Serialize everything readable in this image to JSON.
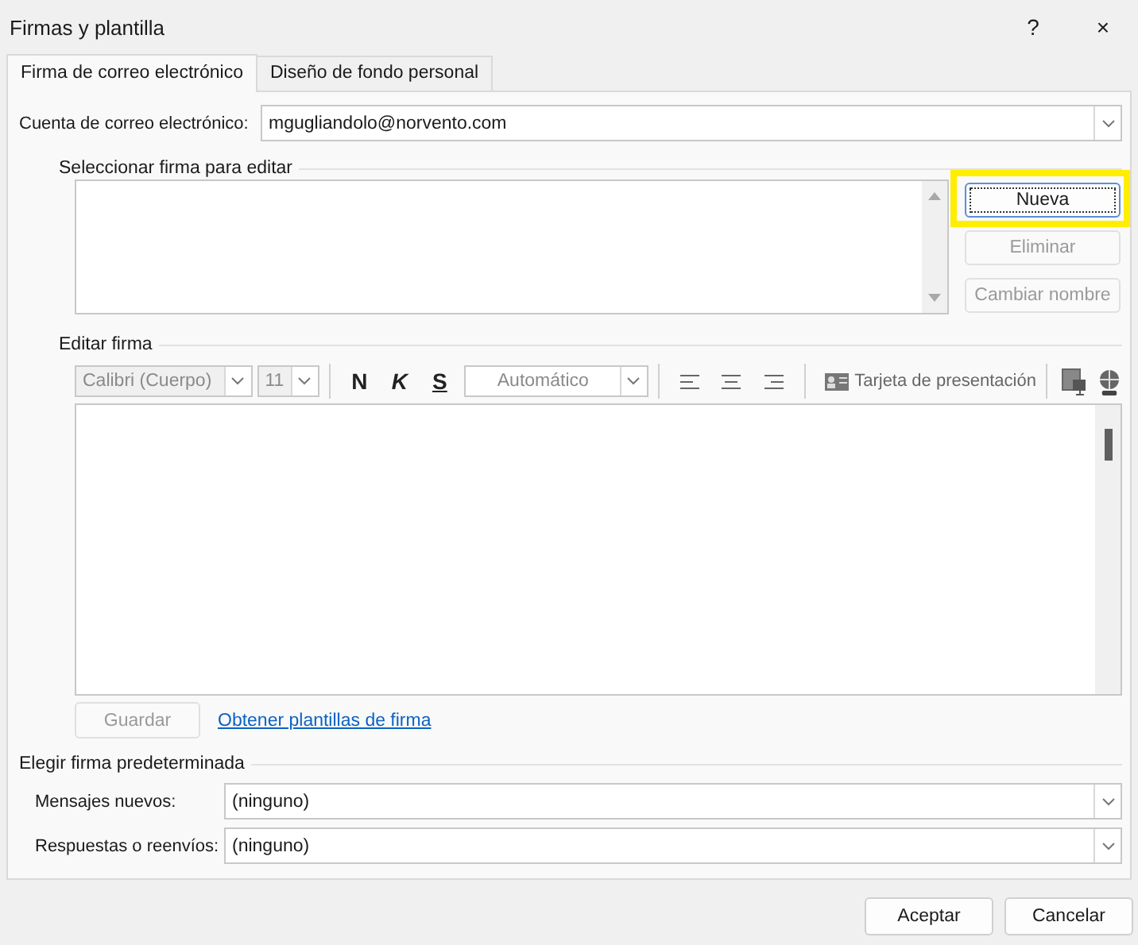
{
  "window": {
    "title": "Firmas y plantilla",
    "help": "?",
    "close": "×"
  },
  "tabs": [
    {
      "label": "Firma de correo electrónico",
      "selected": true
    },
    {
      "label": "Diseño de fondo personal",
      "selected": false
    }
  ],
  "account": {
    "label": "Cuenta de correo electrónico:",
    "value": "mgugliandolo@norvento.com"
  },
  "select_signature": {
    "heading": "Seleccionar firma para editar",
    "buttons": [
      {
        "label": "Nueva",
        "disabled": false,
        "focused": true,
        "highlighted": true
      },
      {
        "label": "Eliminar",
        "disabled": true,
        "focused": false,
        "highlighted": false
      },
      {
        "label": "Cambiar nombre",
        "disabled": true,
        "focused": false,
        "highlighted": false
      }
    ]
  },
  "edit_signature": {
    "heading": "Editar firma",
    "toolbar": {
      "font": "Calibri (Cuerpo)",
      "size": "11",
      "bold": "N",
      "italic": "K",
      "underline": "S",
      "font_color_choice": "Automático",
      "card": "Tarjeta de presentación"
    },
    "save_button": {
      "label": "Guardar",
      "disabled": true
    },
    "link": "Obtener plantillas de firma"
  },
  "defaults": {
    "heading": "Elegir firma predeterminada",
    "fields": [
      {
        "label": "Mensajes nuevos:",
        "value": "(ninguno)"
      },
      {
        "label": "Respuestas o reenvíos:",
        "value": "(ninguno)"
      }
    ]
  },
  "buttons": [
    {
      "label": "Aceptar"
    },
    {
      "label": "Cancelar"
    }
  ]
}
